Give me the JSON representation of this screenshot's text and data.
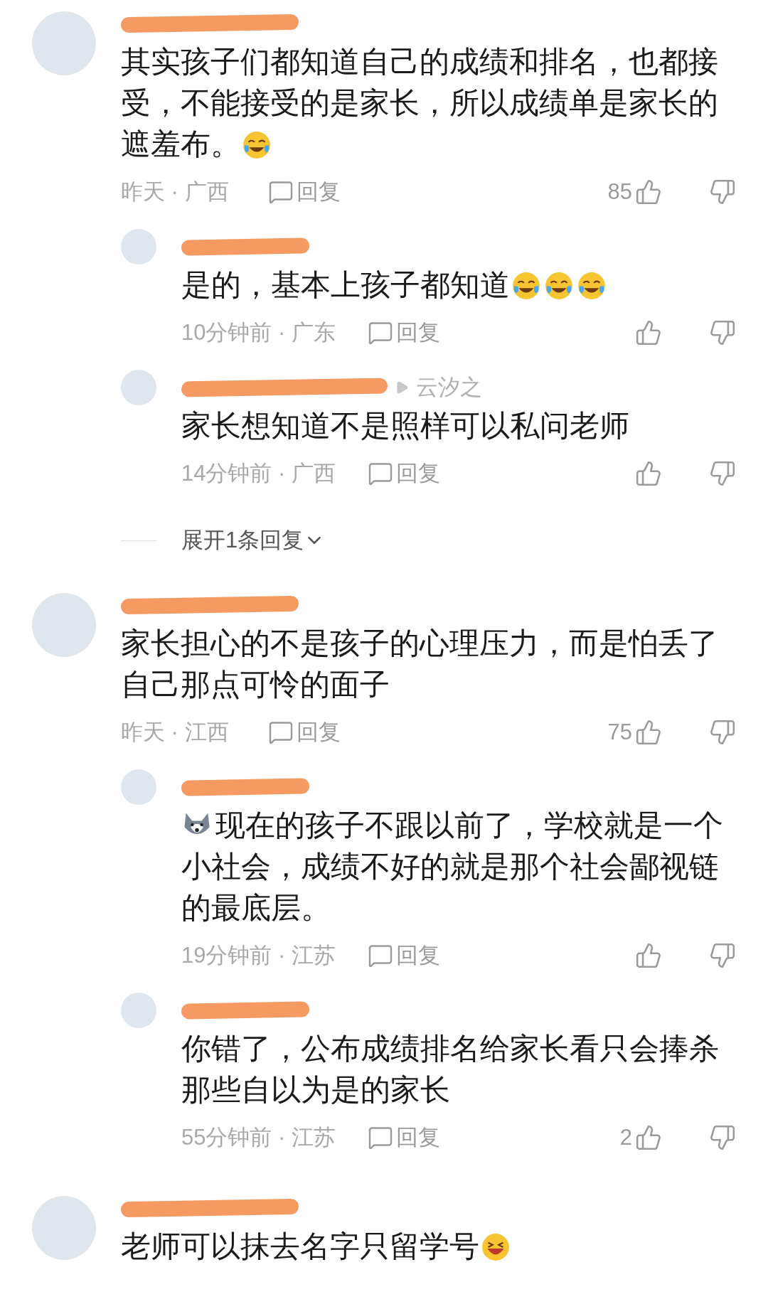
{
  "comments": [
    {
      "parts": [
        {
          "kind": "text",
          "text": "其实孩子们都知道自己的成绩和排名，也都接受，不能接受的是家长，所以成绩单是家长的遮羞布。"
        },
        {
          "kind": "crying"
        }
      ],
      "time": "昨天 · 广西",
      "reply_label": "回复",
      "likes": "85",
      "replies": [
        {
          "parts": [
            {
              "kind": "text",
              "text": "是的，基本上孩子都知道"
            },
            {
              "kind": "crying"
            },
            {
              "kind": "crying"
            },
            {
              "kind": "crying"
            }
          ],
          "time": "10分钟前 · 广东",
          "reply_label": "回复"
        },
        {
          "reply_to": "云汐之",
          "parts": [
            {
              "kind": "text",
              "text": "家长想知道不是照样可以私问老师"
            }
          ],
          "time": "14分钟前 · 广西",
          "reply_label": "回复"
        }
      ],
      "expand": "展开1条回复"
    },
    {
      "parts": [
        {
          "kind": "text",
          "text": "家长担心的不是孩子的心理压力，而是怕丢了自己那点可怜的面子"
        }
      ],
      "time": "昨天 · 江西",
      "reply_label": "回复",
      "likes": "75",
      "replies": [
        {
          "parts": [
            {
              "kind": "dog"
            },
            {
              "kind": "text",
              "text": "现在的孩子不跟以前了，学校就是一个小社会，成绩不好的就是那个社会鄙视链的最底层。"
            }
          ],
          "time": "19分钟前 · 江苏",
          "reply_label": "回复"
        },
        {
          "parts": [
            {
              "kind": "text",
              "text": "你错了，公布成绩排名给家长看只会捧杀那些自以为是的家长"
            }
          ],
          "time": "55分钟前 · 江苏",
          "reply_label": "回复",
          "likes": "2"
        }
      ]
    },
    {
      "parts": [
        {
          "kind": "text",
          "text": "老师可以抹去名字只留学号"
        },
        {
          "kind": "grin"
        }
      ]
    }
  ]
}
